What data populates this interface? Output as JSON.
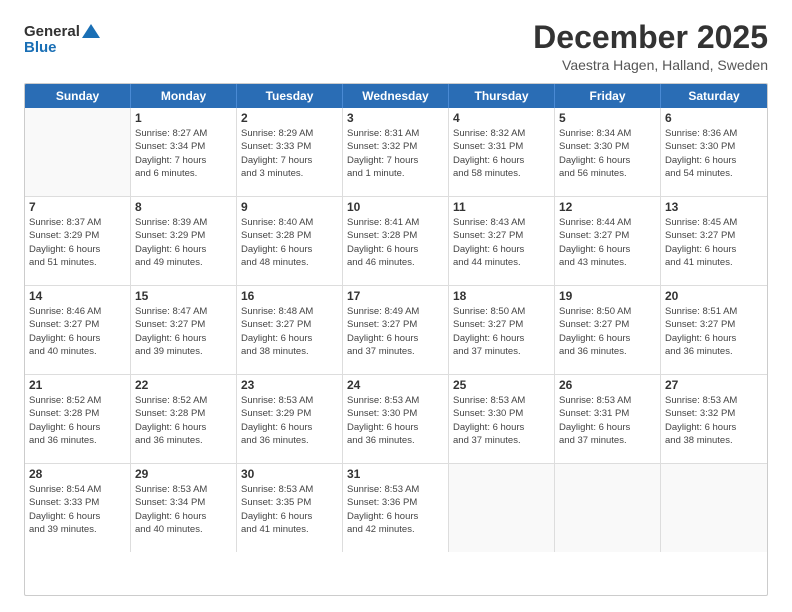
{
  "logo": {
    "general": "General",
    "blue": "Blue",
    "arrow_unicode": "▶"
  },
  "header": {
    "month_title": "December 2025",
    "subtitle": "Vaestra Hagen, Halland, Sweden"
  },
  "days_of_week": [
    "Sunday",
    "Monday",
    "Tuesday",
    "Wednesday",
    "Thursday",
    "Friday",
    "Saturday"
  ],
  "weeks": [
    [
      {
        "day": "",
        "info": ""
      },
      {
        "day": "1",
        "info": "Sunrise: 8:27 AM\nSunset: 3:34 PM\nDaylight: 7 hours\nand 6 minutes."
      },
      {
        "day": "2",
        "info": "Sunrise: 8:29 AM\nSunset: 3:33 PM\nDaylight: 7 hours\nand 3 minutes."
      },
      {
        "day": "3",
        "info": "Sunrise: 8:31 AM\nSunset: 3:32 PM\nDaylight: 7 hours\nand 1 minute."
      },
      {
        "day": "4",
        "info": "Sunrise: 8:32 AM\nSunset: 3:31 PM\nDaylight: 6 hours\nand 58 minutes."
      },
      {
        "day": "5",
        "info": "Sunrise: 8:34 AM\nSunset: 3:30 PM\nDaylight: 6 hours\nand 56 minutes."
      },
      {
        "day": "6",
        "info": "Sunrise: 8:36 AM\nSunset: 3:30 PM\nDaylight: 6 hours\nand 54 minutes."
      }
    ],
    [
      {
        "day": "7",
        "info": "Sunrise: 8:37 AM\nSunset: 3:29 PM\nDaylight: 6 hours\nand 51 minutes."
      },
      {
        "day": "8",
        "info": "Sunrise: 8:39 AM\nSunset: 3:29 PM\nDaylight: 6 hours\nand 49 minutes."
      },
      {
        "day": "9",
        "info": "Sunrise: 8:40 AM\nSunset: 3:28 PM\nDaylight: 6 hours\nand 48 minutes."
      },
      {
        "day": "10",
        "info": "Sunrise: 8:41 AM\nSunset: 3:28 PM\nDaylight: 6 hours\nand 46 minutes."
      },
      {
        "day": "11",
        "info": "Sunrise: 8:43 AM\nSunset: 3:27 PM\nDaylight: 6 hours\nand 44 minutes."
      },
      {
        "day": "12",
        "info": "Sunrise: 8:44 AM\nSunset: 3:27 PM\nDaylight: 6 hours\nand 43 minutes."
      },
      {
        "day": "13",
        "info": "Sunrise: 8:45 AM\nSunset: 3:27 PM\nDaylight: 6 hours\nand 41 minutes."
      }
    ],
    [
      {
        "day": "14",
        "info": "Sunrise: 8:46 AM\nSunset: 3:27 PM\nDaylight: 6 hours\nand 40 minutes."
      },
      {
        "day": "15",
        "info": "Sunrise: 8:47 AM\nSunset: 3:27 PM\nDaylight: 6 hours\nand 39 minutes."
      },
      {
        "day": "16",
        "info": "Sunrise: 8:48 AM\nSunset: 3:27 PM\nDaylight: 6 hours\nand 38 minutes."
      },
      {
        "day": "17",
        "info": "Sunrise: 8:49 AM\nSunset: 3:27 PM\nDaylight: 6 hours\nand 37 minutes."
      },
      {
        "day": "18",
        "info": "Sunrise: 8:50 AM\nSunset: 3:27 PM\nDaylight: 6 hours\nand 37 minutes."
      },
      {
        "day": "19",
        "info": "Sunrise: 8:50 AM\nSunset: 3:27 PM\nDaylight: 6 hours\nand 36 minutes."
      },
      {
        "day": "20",
        "info": "Sunrise: 8:51 AM\nSunset: 3:27 PM\nDaylight: 6 hours\nand 36 minutes."
      }
    ],
    [
      {
        "day": "21",
        "info": "Sunrise: 8:52 AM\nSunset: 3:28 PM\nDaylight: 6 hours\nand 36 minutes."
      },
      {
        "day": "22",
        "info": "Sunrise: 8:52 AM\nSunset: 3:28 PM\nDaylight: 6 hours\nand 36 minutes."
      },
      {
        "day": "23",
        "info": "Sunrise: 8:53 AM\nSunset: 3:29 PM\nDaylight: 6 hours\nand 36 minutes."
      },
      {
        "day": "24",
        "info": "Sunrise: 8:53 AM\nSunset: 3:30 PM\nDaylight: 6 hours\nand 36 minutes."
      },
      {
        "day": "25",
        "info": "Sunrise: 8:53 AM\nSunset: 3:30 PM\nDaylight: 6 hours\nand 37 minutes."
      },
      {
        "day": "26",
        "info": "Sunrise: 8:53 AM\nSunset: 3:31 PM\nDaylight: 6 hours\nand 37 minutes."
      },
      {
        "day": "27",
        "info": "Sunrise: 8:53 AM\nSunset: 3:32 PM\nDaylight: 6 hours\nand 38 minutes."
      }
    ],
    [
      {
        "day": "28",
        "info": "Sunrise: 8:54 AM\nSunset: 3:33 PM\nDaylight: 6 hours\nand 39 minutes."
      },
      {
        "day": "29",
        "info": "Sunrise: 8:53 AM\nSunset: 3:34 PM\nDaylight: 6 hours\nand 40 minutes."
      },
      {
        "day": "30",
        "info": "Sunrise: 8:53 AM\nSunset: 3:35 PM\nDaylight: 6 hours\nand 41 minutes."
      },
      {
        "day": "31",
        "info": "Sunrise: 8:53 AM\nSunset: 3:36 PM\nDaylight: 6 hours\nand 42 minutes."
      },
      {
        "day": "",
        "info": ""
      },
      {
        "day": "",
        "info": ""
      },
      {
        "day": "",
        "info": ""
      }
    ]
  ]
}
